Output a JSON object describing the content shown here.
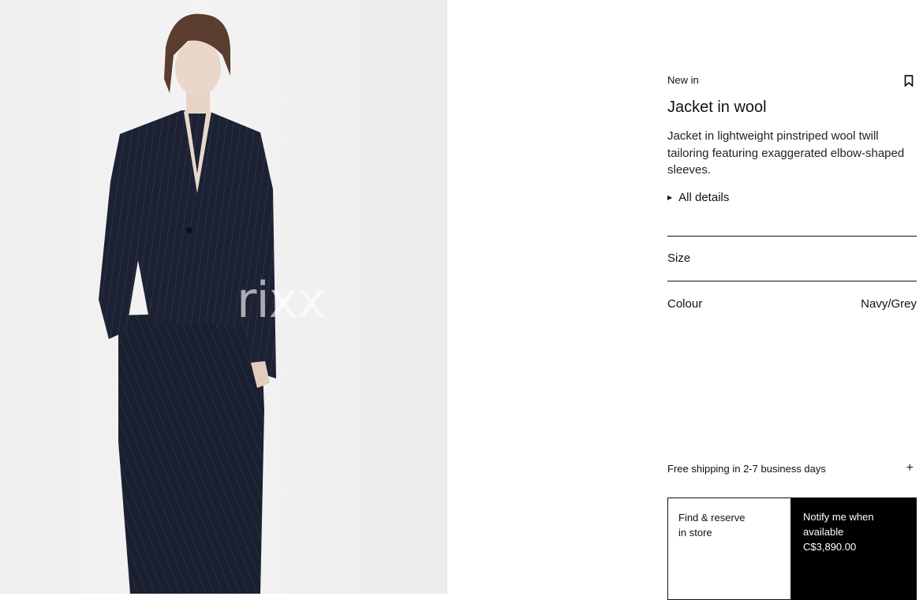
{
  "product": {
    "badge": "New in",
    "title": "Jacket in wool",
    "description": "Jacket in lightweight pinstriped wool twill tailoring featuring exaggerated elbow-shaped sleeves.",
    "details_label": "All details",
    "image_watermark": "rixx"
  },
  "options": {
    "size_label": "Size",
    "colour_label": "Colour",
    "colour_value": "Navy/Grey"
  },
  "shipping": {
    "text": "Free shipping in 2-7 business days",
    "expand_icon": "plus-icon"
  },
  "actions": {
    "find_line1": "Find & reserve",
    "find_line2": "in store",
    "notify_line1": "Notify me when",
    "notify_line2": "available",
    "price": "C$3,890.00"
  },
  "colors": {
    "primary": "#000000",
    "background": "#ffffff",
    "photo_background": "#efefef",
    "garment_navy": "#1c2233"
  }
}
